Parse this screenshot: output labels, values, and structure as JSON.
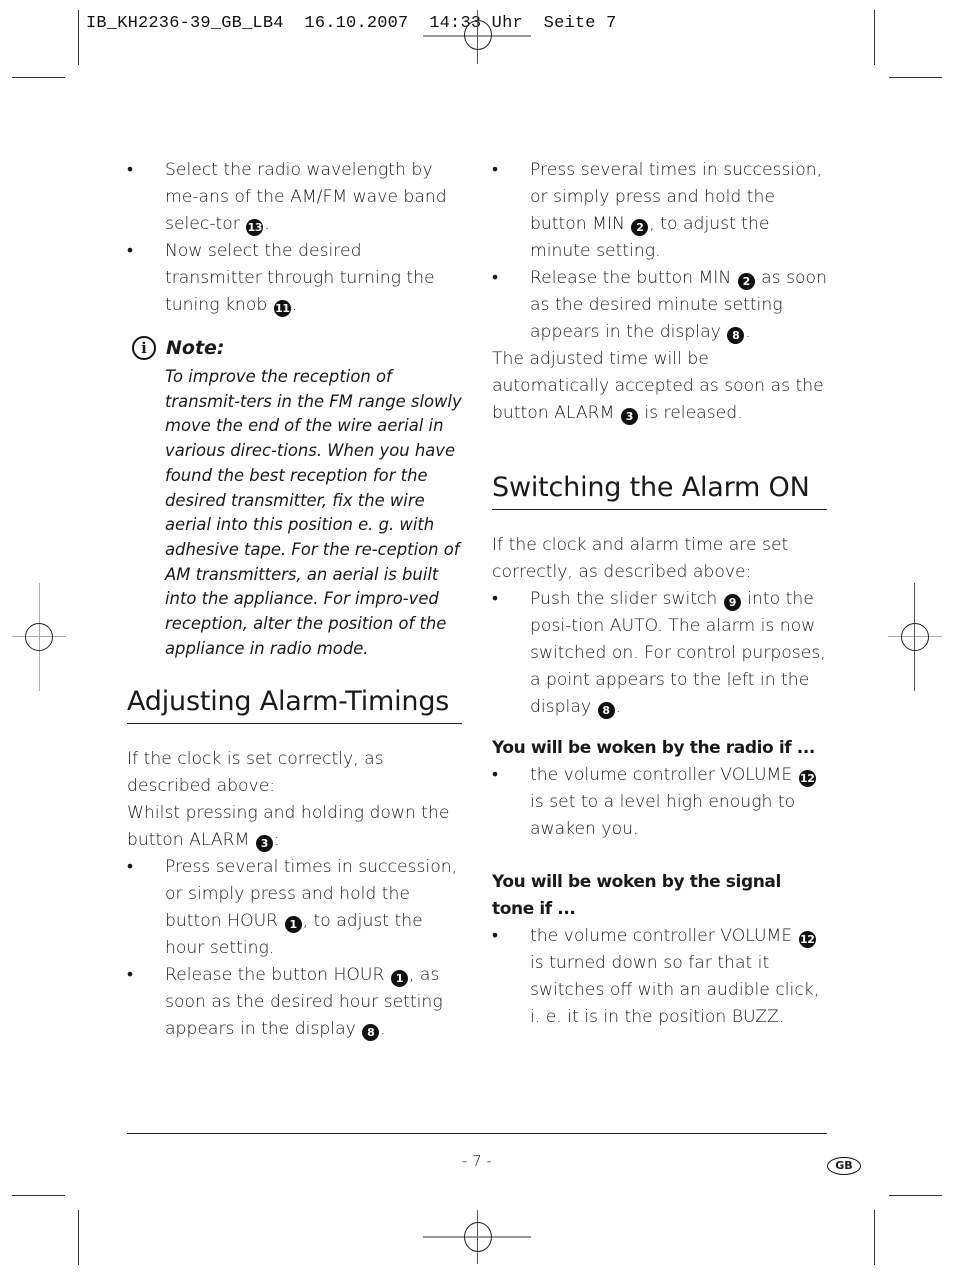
{
  "slug": {
    "text": "IB_KH2236-39_GB_LB4  16.10.2007  14:33 Uhr  Seite 7"
  },
  "left_column": {
    "intro_bullets": [
      {
        "parts": [
          "Select the radio wavelength by me-ans of the AM/FM wave band selec-tor ",
          "13",
          "."
        ]
      },
      {
        "parts": [
          "Now select the desired transmitter through turning the tuning knob ",
          "11",
          "."
        ]
      }
    ],
    "note": {
      "icon": "info-icon",
      "title": "Note:",
      "body": "To improve the reception of transmit-ters in the FM range slowly move the end of the wire aerial in various direc-tions. When you have found the best reception for the desired transmitter, fix the wire aerial into this position e. g. with adhesive tape. For the re-ception of AM transmitters, an aerial is built into the appliance. For impro-ved reception, alter the position of the appliance in radio mode."
    },
    "section": {
      "heading": "Adjusting Alarm-Timings",
      "paragraph1": "If the clock is set correctly, as described above:",
      "paragraph2_text": "Whilst pressing and holding down the button ALARM ",
      "paragraph2_ref": "3",
      "paragraph2_end": ":",
      "bullets": [
        {
          "before": "Press several times in succession, or simply press and hold the button HOUR ",
          "ref": "1",
          "after": ", to adjust the hour setting."
        },
        {
          "before": "Release the button HOUR ",
          "ref": "1",
          "after": ", as soon as the desired hour setting appears in the display "
        },
        {
          "ref2": "8",
          "end": "."
        }
      ]
    }
  },
  "right_column": {
    "bullets": [
      {
        "before": "Press several times in succession, or simply press and hold the button MIN ",
        "ref": "2",
        "after": ", to adjust the minute setting."
      },
      {
        "before": "Release the button MIN ",
        "ref": "2",
        "after": " as soon as the desired minute setting appears in the display ",
        "ref2": "8",
        "end": "."
      }
    ],
    "accepted_text": "The adjusted time will be automatically accepted as soon as the button ALARM ",
    "accepted_ref": "3",
    "accepted_end": " is released.",
    "section": {
      "heading": "Switching the Alarm ON",
      "paragraph": "If the clock and alarm time are set correctly, as described above:",
      "bullet": {
        "before": "Push the slider switch ",
        "ref": "9",
        "after": " into the posi-tion AUTO. The alarm is now switched on. For control purposes, a point appears to the left in the display ",
        "ref2": "8",
        "end": "."
      },
      "radio": {
        "heading": "You will be woken by the radio if ...",
        "bullet_before": "the volume controller VOLUME ",
        "bullet_ref": "12",
        "bullet_after": " is set to a level high enough to awaken you."
      },
      "tone": {
        "heading": "You will be woken by the signal tone if ...",
        "bullet_before": "the volume controller VOLUME ",
        "bullet_ref": "12",
        "bullet_after": " is turned down so far that it switches off with an audible click, i. e. it is in the position BUZZ."
      }
    }
  },
  "footer": {
    "page_number": "- 7 -",
    "language_badge": "GB"
  }
}
